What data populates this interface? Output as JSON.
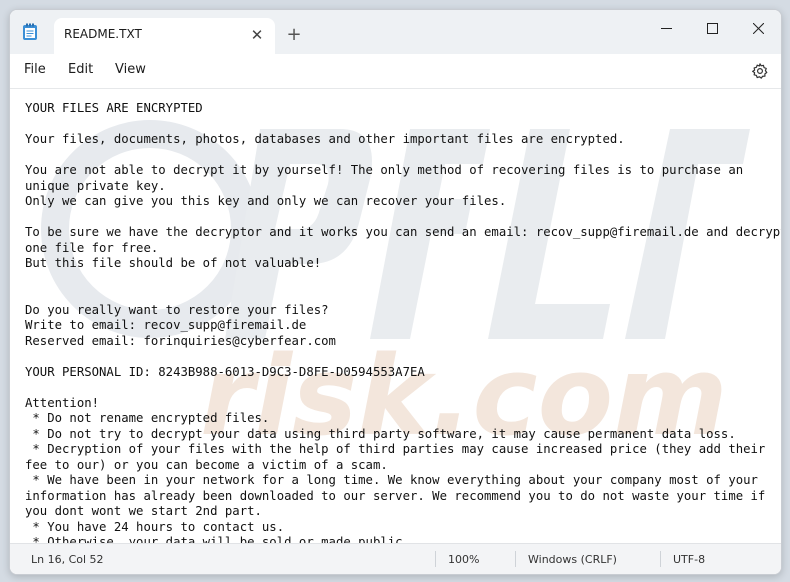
{
  "tab": {
    "title": "README.TXT"
  },
  "menu": {
    "file": "File",
    "edit": "Edit",
    "view": "View"
  },
  "document": {
    "lines": [
      "YOUR FILES ARE ENCRYPTED",
      "",
      "Your files, documents, photos, databases and other important files are encrypted.",
      "",
      "You are not able to decrypt it by yourself! The only method of recovering files is to purchase an",
      "unique private key.",
      "Only we can give you this key and only we can recover your files.",
      "",
      "To be sure we have the decryptor and it works you can send an email: recov_supp@firemail.de and decrypt",
      "one file for free.",
      "But this file should be of not valuable!",
      "",
      "",
      "Do you really want to restore your files?",
      "Write to email: recov_supp@firemail.de",
      "Reserved email: forinquiries@cyberfear.com",
      "",
      "YOUR PERSONAL ID: 8243B988-6013-D9C3-D8FE-D0594553A7EA",
      "",
      "Attention!",
      " * Do not rename encrypted files.",
      " * Do not try to decrypt your data using third party software, it may cause permanent data loss.",
      " * Decryption of your files with the help of third parties may cause increased price (they add their",
      "fee to our) or you can become a victim of a scam.",
      " * We have been in your network for a long time. We know everything about your company most of your",
      "information has already been downloaded to our server. We recommend you to do not waste your time if",
      "you dont wont we start 2nd part.",
      " * You have 24 hours to contact us.",
      " * Otherwise, your data will be sold or made public."
    ]
  },
  "status": {
    "position": "Ln 16, Col 52",
    "zoom": "100%",
    "line_ending": "Windows (CRLF)",
    "encoding": "UTF-8"
  },
  "colors": {
    "accent": "#0f6cbd",
    "watermark": "#e5e8ec"
  }
}
